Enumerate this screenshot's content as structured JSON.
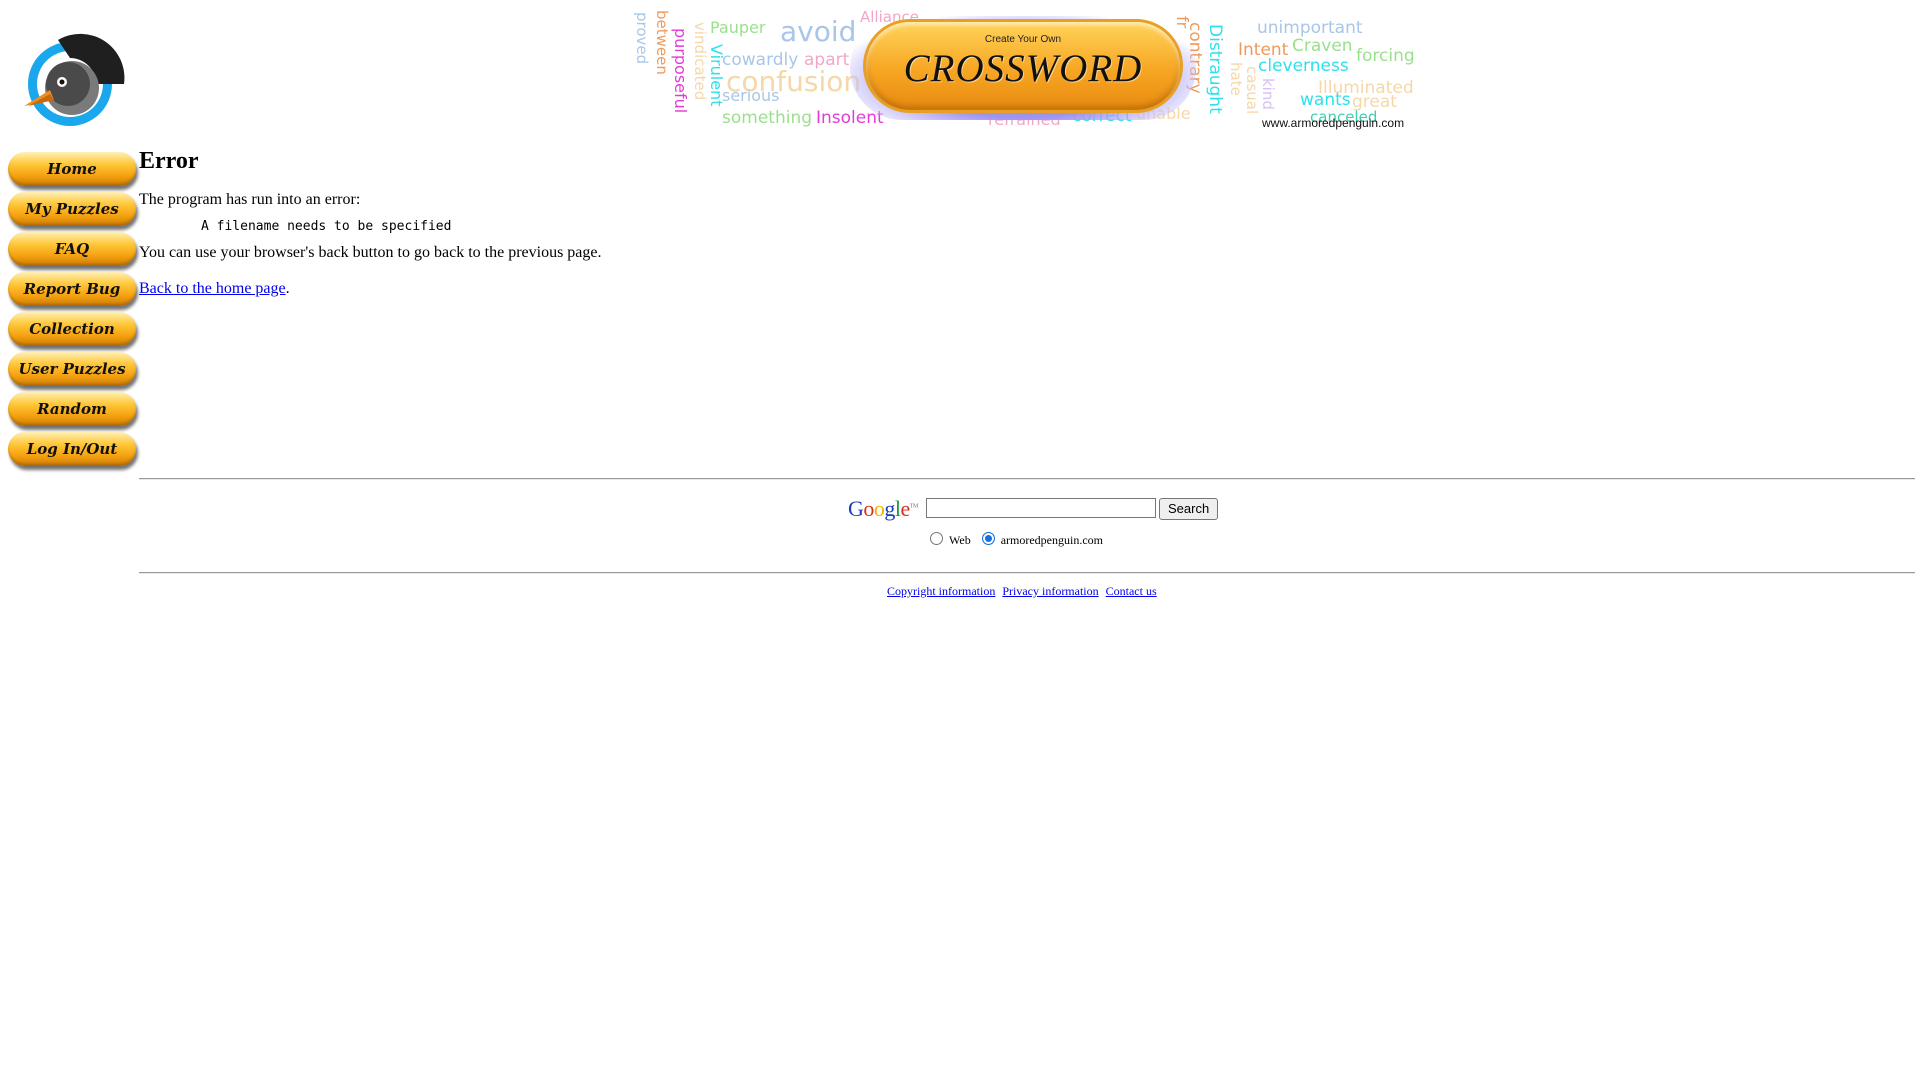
{
  "logo": {
    "alt": "armored penguin logo",
    "colors": {
      "ring": "#1aa7ec",
      "head": "#222222",
      "beak": "#f28c1c"
    }
  },
  "banner": {
    "subtitle": "Create Your Own",
    "title": "CROSSWORD",
    "url": "www.armoredpenguin.com",
    "words": [
      "proved",
      "between",
      "purposeful",
      "vindicated",
      "Virulent",
      "Pauper",
      "cowardly",
      "apart",
      "avoid",
      "Alliance",
      "confusion",
      "serious",
      "something",
      "Insolent",
      "refrained",
      "correct",
      "unable",
      "Distraught",
      "contrary",
      "fr",
      "Intent",
      "unimportant",
      "Craven",
      "cleverness",
      "forcing",
      "hate",
      "casual",
      "kind",
      "Illuminated",
      "wants",
      "great",
      "canceled",
      "daughtinally"
    ]
  },
  "nav": {
    "items": [
      "Home",
      "My Puzzles",
      "FAQ",
      "Report Bug",
      "Collection",
      "User Puzzles",
      "Random",
      "Log In/Out"
    ]
  },
  "main": {
    "heading": "Error",
    "intro": "The program has run into an error:",
    "error_message": "A filename needs to be specified",
    "back_hint": "You can use your browser's back button to go back to the previous page.",
    "home_link": "Back to the home page",
    "home_link_suffix": "."
  },
  "search": {
    "logo_text": "Google",
    "tm": "TM",
    "query": "",
    "button": "Search",
    "options": [
      {
        "label": "Web",
        "selected": false
      },
      {
        "label": "armoredpenguin.com",
        "selected": true
      }
    ]
  },
  "footer": {
    "links": [
      "Copyright information",
      "Privacy information",
      "Contact us"
    ]
  }
}
